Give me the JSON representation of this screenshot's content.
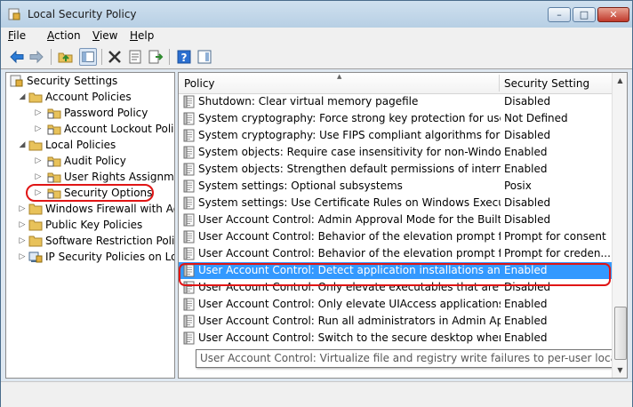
{
  "window": {
    "title": "Local Security Policy",
    "controls": {
      "minimize": "–",
      "maximize": "□",
      "close": "✕"
    }
  },
  "menubar": {
    "items": [
      {
        "label_ul": "F",
        "label_rest": "ile"
      },
      {
        "label_ul": "A",
        "label_rest": "ction"
      },
      {
        "label_ul": "V",
        "label_rest": "iew"
      },
      {
        "label_ul": "H",
        "label_rest": "elp"
      }
    ]
  },
  "toolbar": {
    "icons": [
      "back-icon",
      "forward-icon",
      "up-folder-icon",
      "show-hide-tree-icon",
      "delete-icon",
      "properties-icon",
      "export-list-icon",
      "help-icon",
      "mmc-panel-icon"
    ]
  },
  "tree": {
    "items": [
      {
        "label": "Security Settings",
        "level": 0,
        "expander": ""
      },
      {
        "label": "Account Policies",
        "level": 1,
        "expander": "◢"
      },
      {
        "label": "Password Policy",
        "level": 2,
        "expander": "▷"
      },
      {
        "label": "Account Lockout Policy",
        "level": 2,
        "expander": "▷"
      },
      {
        "label": "Local Policies",
        "level": 1,
        "expander": "◢"
      },
      {
        "label": "Audit Policy",
        "level": 2,
        "expander": "▷"
      },
      {
        "label": "User Rights Assignment",
        "level": 2,
        "expander": "▷"
      },
      {
        "label": "Security Options",
        "level": 2,
        "expander": "▷"
      },
      {
        "label": "Windows Firewall with Advanced Security",
        "level": 1,
        "expander": "▷"
      },
      {
        "label": "Public Key Policies",
        "level": 1,
        "expander": "▷"
      },
      {
        "label": "Software Restriction Policies",
        "level": 1,
        "expander": "▷"
      },
      {
        "label": "IP Security Policies on Local Computer",
        "level": 1,
        "expander": "▷"
      }
    ]
  },
  "list": {
    "columns": {
      "policy": "Policy",
      "setting": "Security Setting"
    },
    "rows": [
      {
        "policy": "Shutdown: Clear virtual memory pagefile",
        "setting": "Disabled"
      },
      {
        "policy": "System cryptography: Force strong key protection for user key...",
        "setting": "Not Defined"
      },
      {
        "policy": "System cryptography: Use FIPS compliant algorithms for encr...",
        "setting": "Disabled"
      },
      {
        "policy": "System objects: Require case insensitivity for non-Windows sub...",
        "setting": "Enabled"
      },
      {
        "policy": "System objects: Strengthen default permissions of internal sys...",
        "setting": "Enabled"
      },
      {
        "policy": "System settings: Optional subsystems",
        "setting": "Posix"
      },
      {
        "policy": "System settings: Use Certificate Rules on Windows Executable...",
        "setting": "Disabled"
      },
      {
        "policy": "User Account Control: Admin Approval Mode for the Built-in ...",
        "setting": "Disabled"
      },
      {
        "policy": "User Account Control: Behavior of the elevation prompt for a...",
        "setting": "Prompt for consent"
      },
      {
        "policy": "User Account Control: Behavior of the elevation prompt for st...",
        "setting": "Prompt for creden..."
      },
      {
        "policy": "User Account Control: Detect application installations and pro...",
        "setting": "Enabled"
      },
      {
        "policy": "User Account Control: Only elevate executables that are signe...",
        "setting": "Disabled"
      },
      {
        "policy": "User Account Control: Only elevate UIAccess applications that...",
        "setting": "Enabled"
      },
      {
        "policy": "User Account Control: Run all administrators in Admin Appro...",
        "setting": "Enabled"
      },
      {
        "policy": "User Account Control: Switch to the secure desktop when pro...",
        "setting": "Enabled"
      }
    ],
    "tooltip": "User Account Control: Virtualize file and registry write failures to per-user locations"
  }
}
